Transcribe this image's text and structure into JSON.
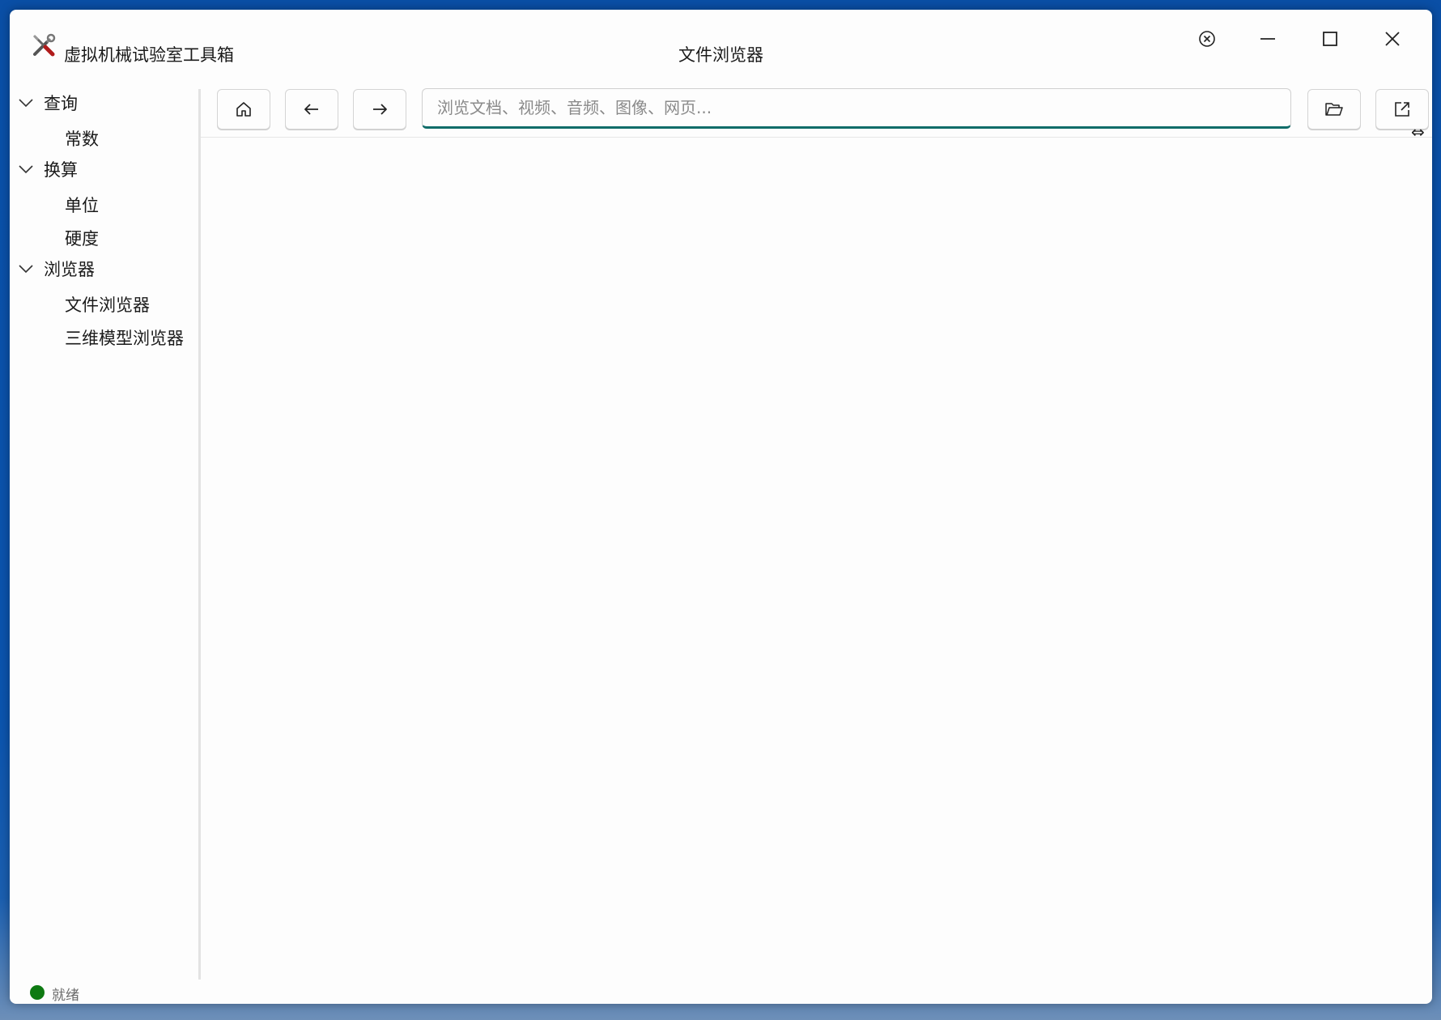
{
  "window": {
    "app_title": "虚拟机械试验室工具箱",
    "page_title": "文件浏览器"
  },
  "titlebar_controls": {
    "settings_icon": "close-circle-icon",
    "minimize_icon": "minimize-icon",
    "maximize_icon": "maximize-icon",
    "close_icon": "close-icon"
  },
  "sidebar": {
    "groups": [
      {
        "label": "查询",
        "expanded": true,
        "items": [
          {
            "label": "常数"
          }
        ]
      },
      {
        "label": "换算",
        "expanded": true,
        "items": [
          {
            "label": "单位"
          },
          {
            "label": "硬度"
          }
        ]
      },
      {
        "label": "浏览器",
        "expanded": true,
        "items": [
          {
            "label": "文件浏览器"
          },
          {
            "label": "三维模型浏览器"
          }
        ]
      }
    ]
  },
  "toolbar": {
    "home_icon": "home-icon",
    "back_icon": "arrow-left-icon",
    "forward_icon": "arrow-right-icon",
    "search_placeholder": "浏览文档、视频、音频、图像、网页...",
    "search_value": "",
    "open_icon": "folder-open-icon",
    "external_icon": "open-external-icon"
  },
  "status": {
    "text": "就绪",
    "color": "#0e7a12"
  },
  "colors": {
    "accent": "#0f6c69",
    "desktop": "#0b54ae"
  }
}
